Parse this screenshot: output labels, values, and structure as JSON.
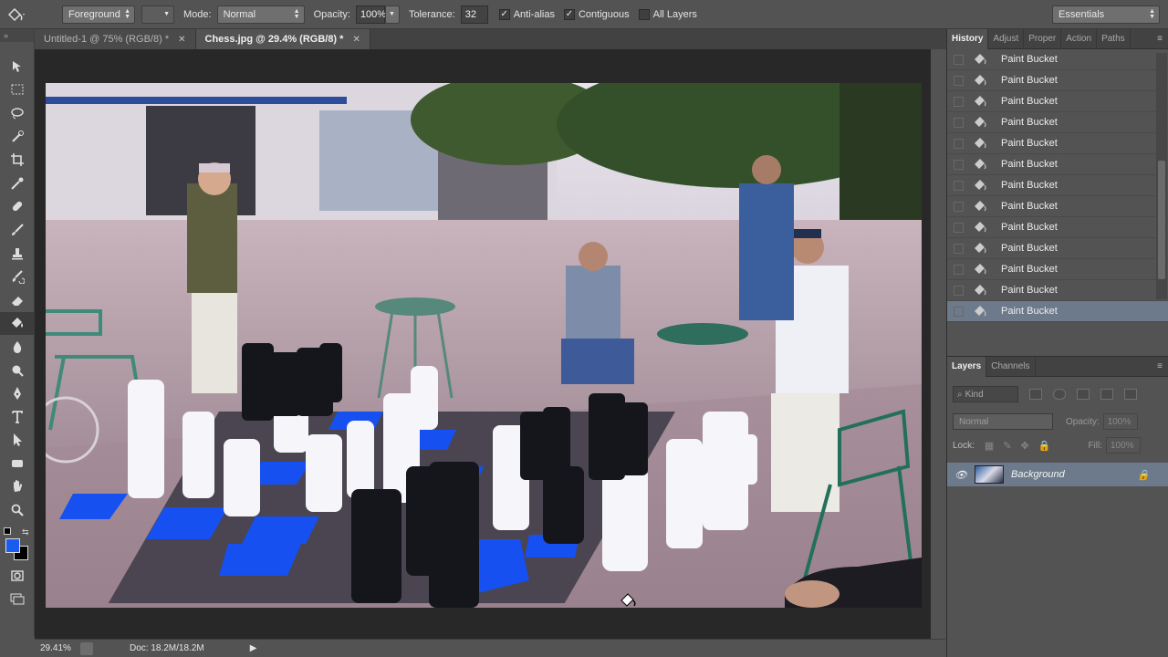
{
  "options_bar": {
    "fill_source": "Foreground",
    "mode_label": "Mode:",
    "mode_value": "Normal",
    "opacity_label": "Opacity:",
    "opacity_value": "100%",
    "tolerance_label": "Tolerance:",
    "tolerance_value": "32",
    "anti_alias_label": "Anti-alias",
    "contiguous_label": "Contiguous",
    "all_layers_label": "All Layers",
    "workspace": "Essentials"
  },
  "tabs": [
    {
      "label": "Untitled-1 @ 75% (RGB/8) *",
      "active": false
    },
    {
      "label": "Chess.jpg @ 29.4% (RGB/8) *",
      "active": true
    }
  ],
  "toolbar": {
    "tools": [
      "move-tool",
      "marquee-tool",
      "lasso-tool",
      "quick-selection-tool",
      "crop-tool",
      "eyedropper-tool",
      "healing-brush-tool",
      "brush-tool",
      "clone-stamp-tool",
      "history-brush-tool",
      "eraser-tool",
      "paint-bucket-tool",
      "blur-tool",
      "dodge-tool",
      "pen-tool",
      "type-tool",
      "path-selection-tool",
      "shape-tool",
      "hand-tool",
      "zoom-tool"
    ],
    "active_tool": "paint-bucket-tool",
    "foreground_color": "#1a5cf0",
    "background_color": "#000000"
  },
  "status": {
    "zoom": "29.41%",
    "doc": "Doc: 18.2M/18.2M"
  },
  "history_panel": {
    "tabs": [
      "History",
      "Adjust",
      "Proper",
      "Action",
      "Paths"
    ],
    "items": [
      "Paint Bucket",
      "Paint Bucket",
      "Paint Bucket",
      "Paint Bucket",
      "Paint Bucket",
      "Paint Bucket",
      "Paint Bucket",
      "Paint Bucket",
      "Paint Bucket",
      "Paint Bucket",
      "Paint Bucket",
      "Paint Bucket",
      "Paint Bucket"
    ]
  },
  "layers_panel": {
    "tabs": [
      "Layers",
      "Channels"
    ],
    "kind_label": "Kind",
    "blend_mode": "Normal",
    "opacity_label": "Opacity:",
    "opacity_value": "100%",
    "lock_label": "Lock:",
    "fill_label": "Fill:",
    "fill_value": "100%",
    "layers": [
      {
        "name": "Background"
      }
    ]
  }
}
